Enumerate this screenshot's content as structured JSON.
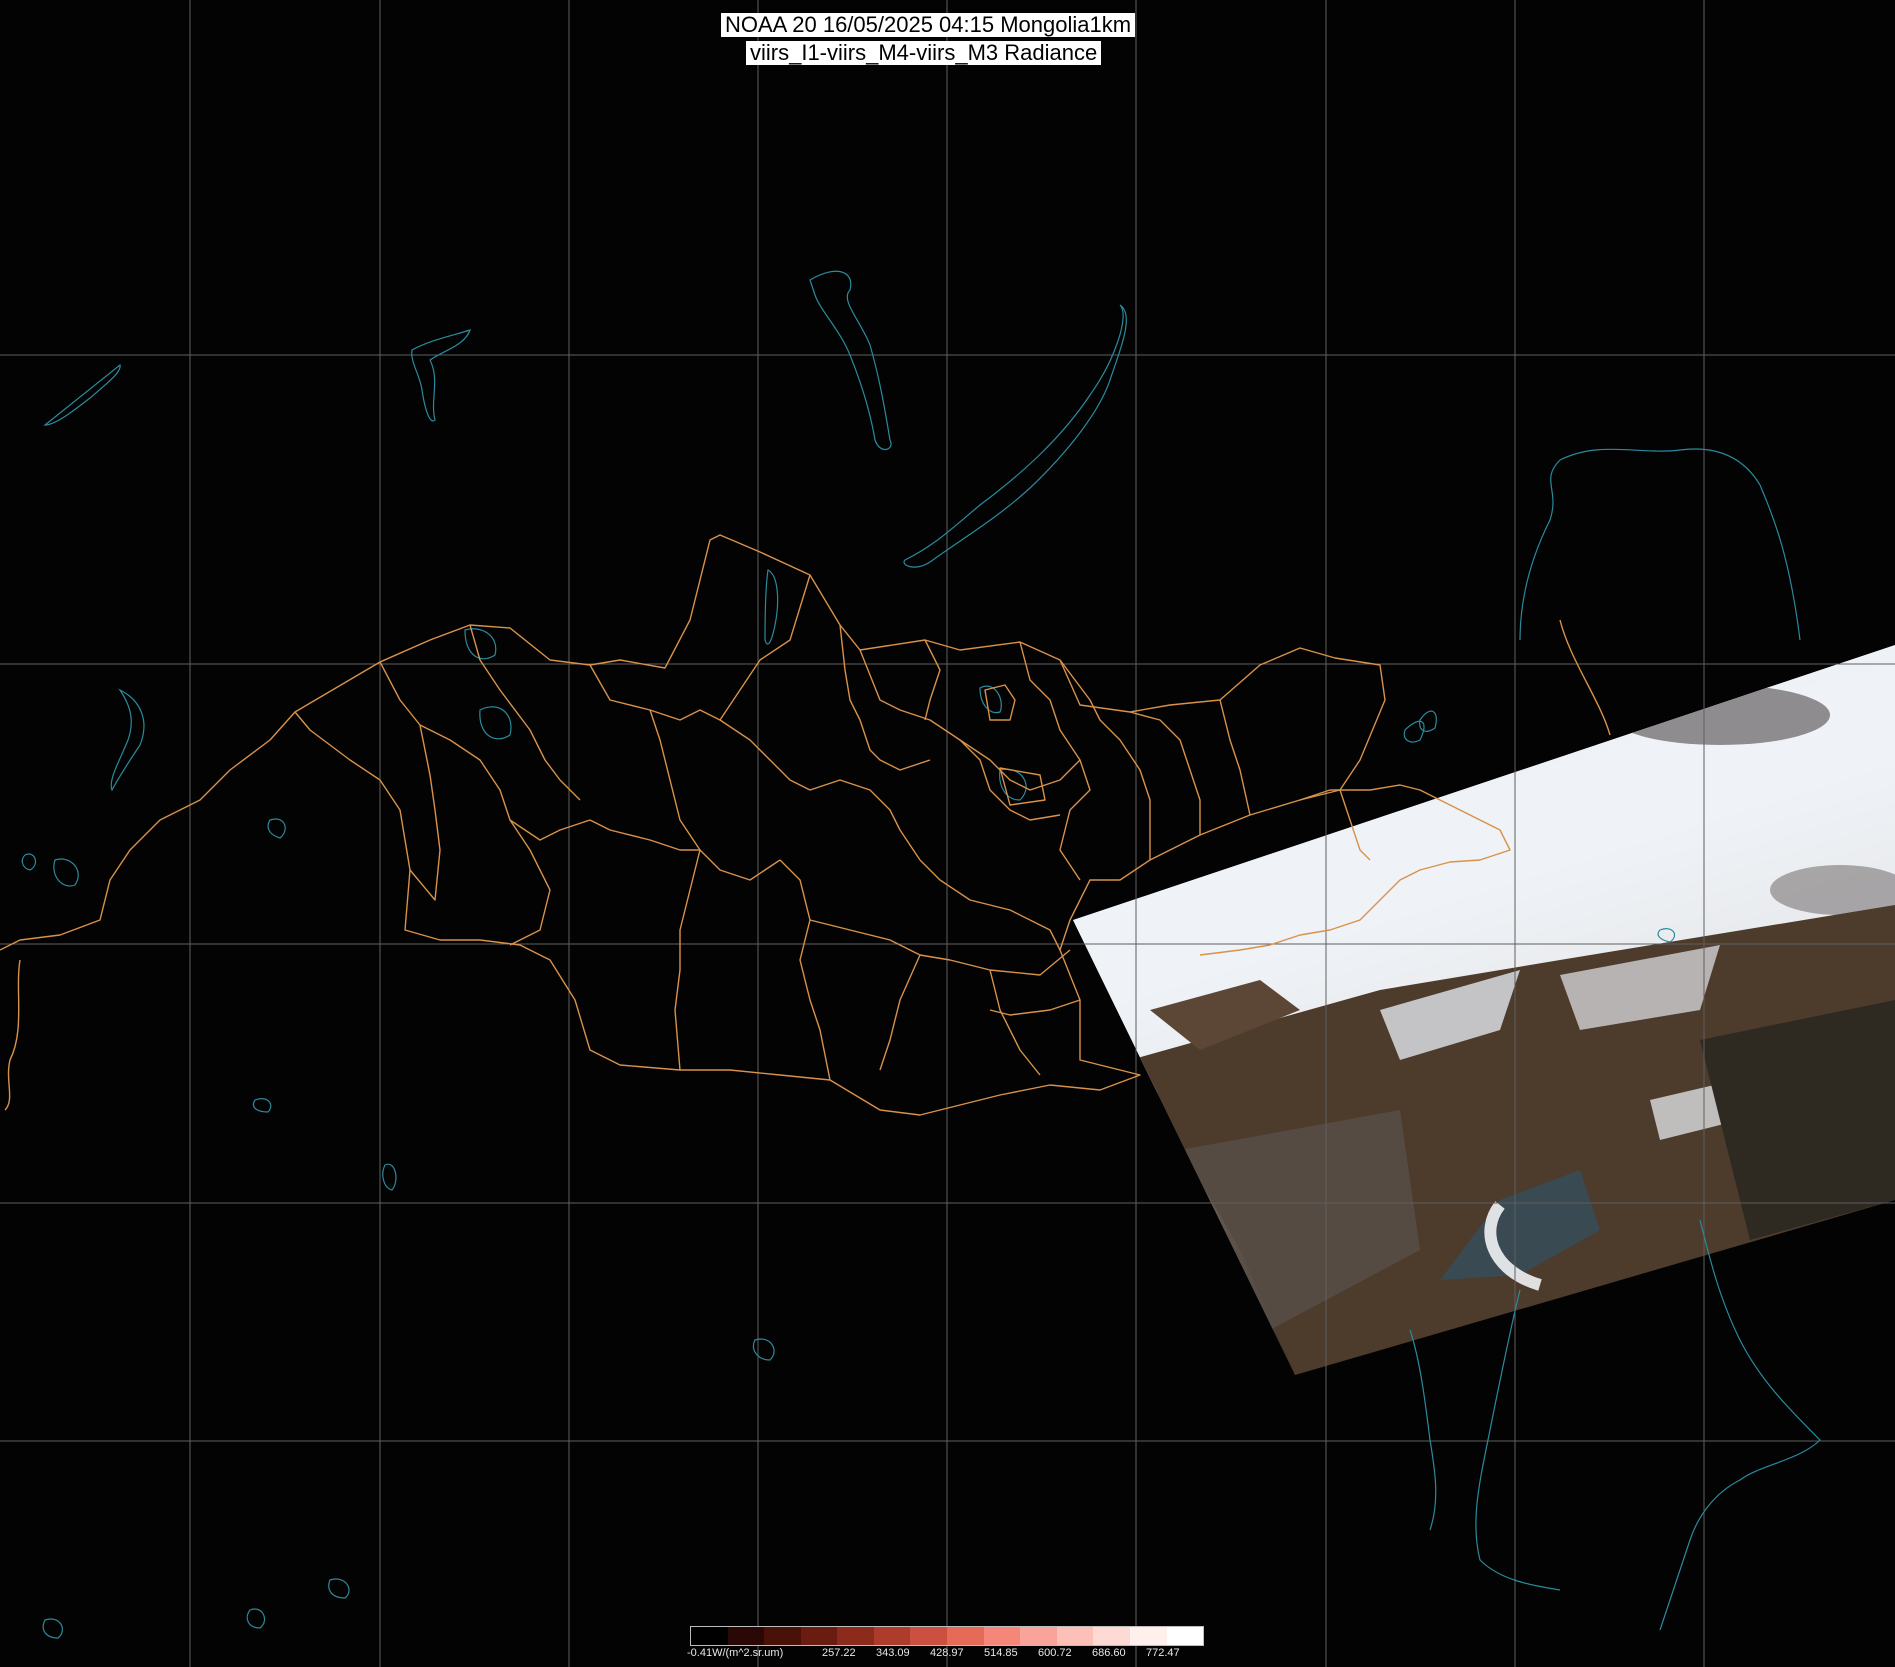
{
  "title": {
    "line1": "NOAA 20 16/05/2025 04:15 Mongolia1km",
    "line2": "viirs_I1-viirs_M4-viirs_M3 Radiance"
  },
  "colorbar": {
    "unit_label": "-0.41W/(m^2.sr.um)",
    "tick_labels": [
      "257.22",
      "343.09",
      "428.97",
      "514.85",
      "600.72",
      "686.60",
      "772.47"
    ],
    "colors": [
      "#000000",
      "#2a0805",
      "#4a1108",
      "#6a1c10",
      "#8c2a1c",
      "#ad3c2c",
      "#cc5040",
      "#e66a58",
      "#f4867a",
      "#f9a49a",
      "#fcc0b8",
      "#fedad4",
      "#fff0ee",
      "#ffffff"
    ]
  },
  "colors": {
    "background": "#030303",
    "graticule": "#5f5f5f",
    "admin_boundary": "#d8924a",
    "coastline_water": "#2b8a9e",
    "cloud": "#eef1f6",
    "land": "#4a3a2d"
  }
}
